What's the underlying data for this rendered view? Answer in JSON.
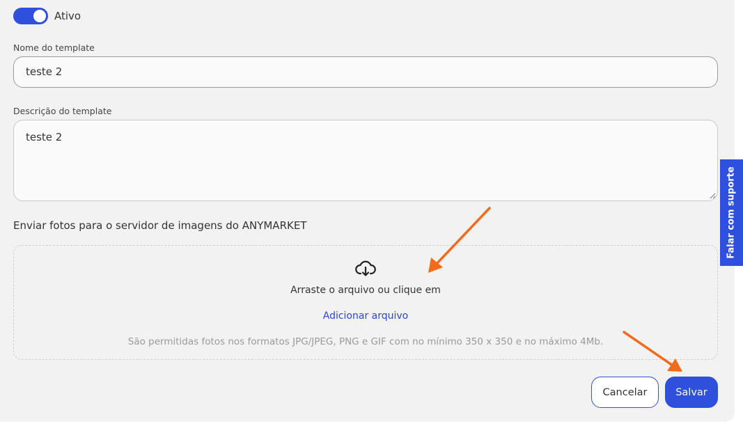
{
  "toggle": {
    "label": "Ativo",
    "checked": true,
    "accent": "#2f4fdd"
  },
  "name_field": {
    "label": "Nome do template",
    "value": "teste 2"
  },
  "description_field": {
    "label": "Descrição do template",
    "value": "teste 2"
  },
  "upload": {
    "title": "Enviar fotos para o servidor de imagens do ANYMARKET",
    "icon": "cloud-download-icon",
    "drag_text": "Arraste o arquivo ou clique em",
    "link_label": "Adicionar arquivo",
    "hint": "São permitidas fotos nos formatos JPG/JPEG, PNG e GIF com no mínimo 350 x 350 e no máximo 4Mb."
  },
  "actions": {
    "cancel_label": "Cancelar",
    "save_label": "Salvar"
  },
  "support_tab": {
    "label": "Falar com suporte"
  },
  "annotation_color": "#f26a1b"
}
